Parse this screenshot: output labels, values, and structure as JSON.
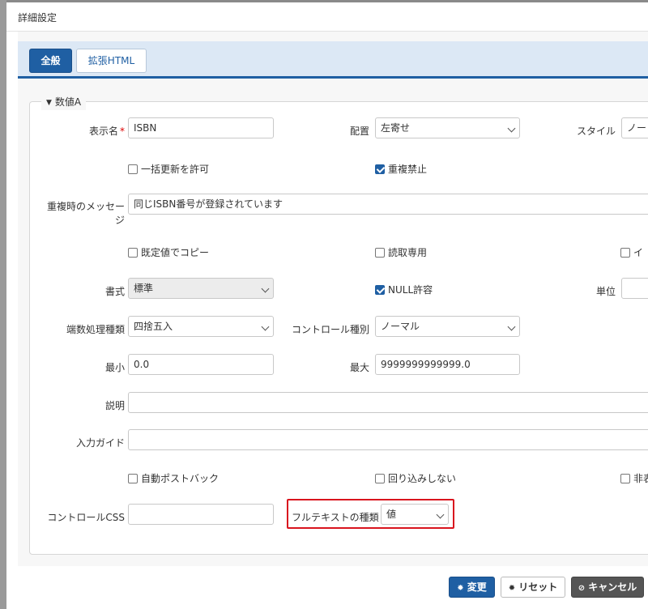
{
  "dialog": {
    "title": "詳細設定"
  },
  "tabs": [
    {
      "label": "全般"
    },
    {
      "label": "拡張HTML"
    }
  ],
  "section": {
    "legend": "数値A"
  },
  "fields": {
    "display_name": {
      "label": "表示名",
      "required_mark": "*",
      "value": "ISBN"
    },
    "alignment": {
      "label": "配置",
      "value": "左寄せ"
    },
    "style": {
      "label": "スタイル",
      "value": "ノー"
    },
    "bulk_update": {
      "label": "一括更新を許可",
      "checked": false
    },
    "no_duplicate": {
      "label": "重複禁止",
      "checked": true
    },
    "duplicate_message": {
      "label_line1": "重複時のメッセー",
      "label_line2": "ジ",
      "value": "同じISBN番号が登録されています"
    },
    "copy_default": {
      "label": "既定値でコピー",
      "checked": false
    },
    "read_only": {
      "label": "読取専用",
      "checked": false
    },
    "third_checkbox": {
      "label": "イ",
      "checked": false
    },
    "format": {
      "label": "書式",
      "value": "標準"
    },
    "null_allowed": {
      "label": "NULL許容",
      "checked": true
    },
    "unit": {
      "label": "単位",
      "value": ""
    },
    "rounding": {
      "label": "端数処理種類",
      "value": "四捨五入"
    },
    "control_type": {
      "label": "コントロール種別",
      "value": "ノーマル"
    },
    "min": {
      "label": "最小",
      "value": "0.0"
    },
    "max": {
      "label": "最大",
      "value": "9999999999999.0"
    },
    "description": {
      "label": "説明",
      "value": ""
    },
    "input_guide": {
      "label": "入力ガイド",
      "value": ""
    },
    "auto_postback": {
      "label": "自動ポストバック",
      "checked": false
    },
    "no_wrap": {
      "label": "回り込みしない",
      "checked": false
    },
    "hidden": {
      "label": "非表",
      "checked": false
    },
    "control_css": {
      "label": "コントロールCSS",
      "value": ""
    },
    "fulltext_type": {
      "label": "フルテキストの種類",
      "value": "値"
    }
  },
  "buttons": {
    "change": {
      "label": "変更",
      "icon": "gear-icon"
    },
    "reset": {
      "label": "リセット",
      "icon": "gear-icon"
    },
    "cancel": {
      "label": "キャンセル",
      "icon": "ban-icon"
    }
  },
  "colors": {
    "primary": "#1f5fa3",
    "highlight": "#d9141e",
    "tab_bar": "#dce8f5"
  }
}
